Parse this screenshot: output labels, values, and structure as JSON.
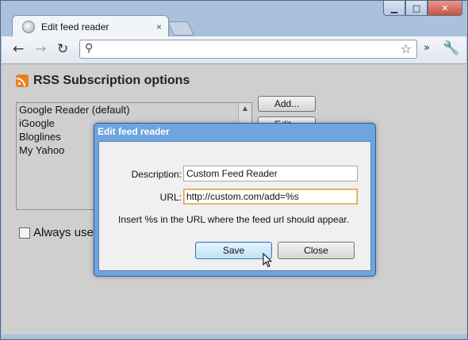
{
  "window": {
    "controls": {
      "minimize": "▁",
      "maximize": "□",
      "close": "✕"
    }
  },
  "tab": {
    "title": "Edit feed reader",
    "close": "×"
  },
  "toolbar": {
    "back": "←",
    "forward": "→",
    "reload": "↻",
    "omnibox_value": "",
    "search_icon": "⚲",
    "star_icon": "☆",
    "chevron": "»",
    "wrench_icon": "🔧"
  },
  "page": {
    "heading": "RSS Subscription options",
    "readers": [
      "Google Reader (default)",
      "iGoogle",
      "Bloglines",
      "My Yahoo"
    ],
    "add_button": "Add...",
    "edit_button": "Edit...",
    "always_use_label": "Always use"
  },
  "dialog": {
    "title": "Edit feed reader",
    "description_label": "Description:",
    "description_value": "Custom Feed Reader",
    "url_label": "URL:",
    "url_value": "http://custom.com/add=%s",
    "hint": "Insert %s in the URL where the feed url should appear.",
    "save_button": "Save",
    "close_button": "Close"
  },
  "colors": {
    "dialog_frame": "#6fa5df",
    "content_bg": "#cfcfcf",
    "rss_orange": "#e8801c",
    "focus_border": "#e0a14a"
  }
}
